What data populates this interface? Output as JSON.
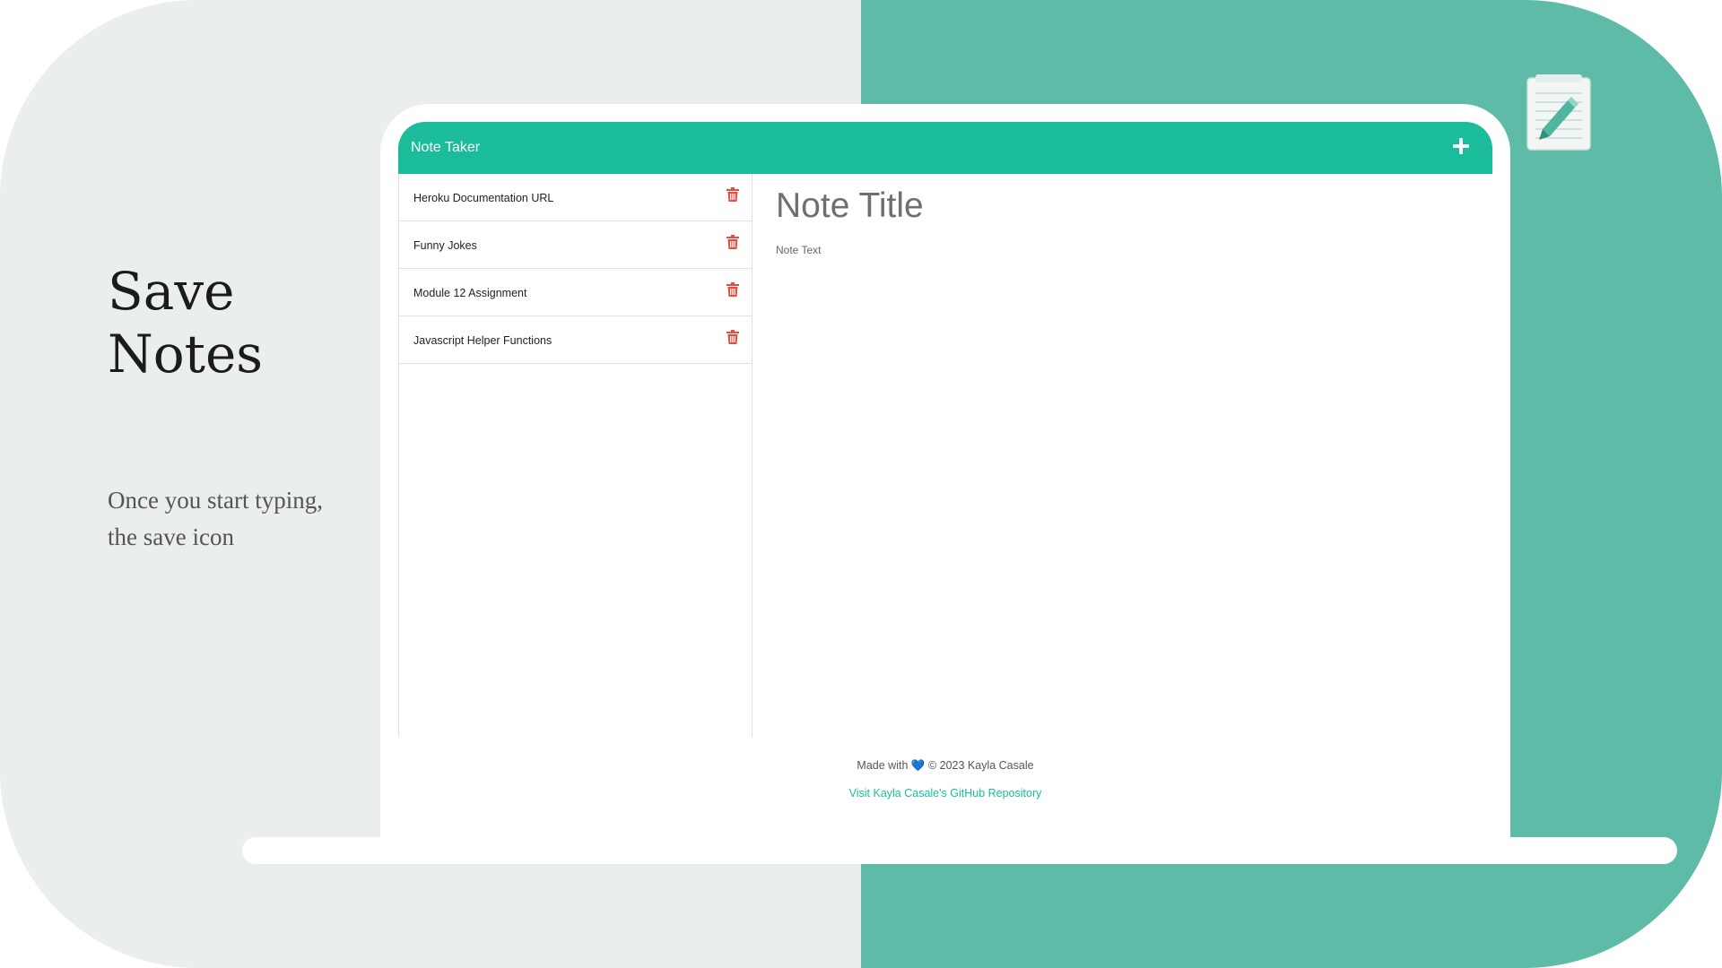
{
  "slide": {
    "title_line1": "Save",
    "title_line2": "Notes",
    "description": "Once you start typing, the save icon"
  },
  "app": {
    "brand": "Note Taker",
    "new_note_icon": "plus-icon",
    "notes": [
      {
        "title": "Heroku Documentation URL",
        "delete_icon": "trash-icon"
      },
      {
        "title": "Funny Jokes",
        "delete_icon": "trash-icon"
      },
      {
        "title": "Module 12 Assignment",
        "delete_icon": "trash-icon"
      },
      {
        "title": "Javascript Helper Functions",
        "delete_icon": "trash-icon"
      }
    ],
    "editor": {
      "title_placeholder": "Note Title",
      "text_placeholder": "Note Text"
    }
  },
  "footer": {
    "made_with_prefix": "Made with",
    "heart": "💙",
    "copyright": "© 2023 Kayla Casale",
    "repo_link": "Visit Kayla Casale's GitHub Repository"
  },
  "colors": {
    "bg_left": "#ebeeee",
    "bg_right": "#5dbba7",
    "navbar": "#1abc9c",
    "trash": "#e74c3c",
    "link": "#1abc9c"
  }
}
